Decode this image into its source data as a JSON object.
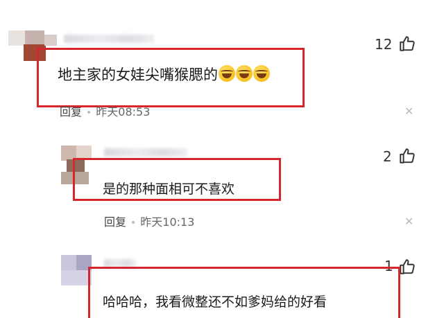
{
  "comments": [
    {
      "text": "地主家的女娃尖嘴猴腮的",
      "emojis": [
        "laughing-crying-emoji",
        "laughing-crying-emoji",
        "laughing-crying-emoji"
      ],
      "likes": "12",
      "reply_label": "回复",
      "time": "昨天08:53",
      "highlighted": true
    },
    {
      "text": "是的那种面相可不喜欢",
      "likes": "2",
      "reply_label": "回复",
      "time": "昨天10:13",
      "highlighted": true
    },
    {
      "text": "哈哈哈，我看微整还不如爹妈给的好看",
      "likes": "1",
      "highlighted": true
    }
  ],
  "icons": {
    "like": "thumbs-up-icon",
    "close": "close-icon"
  },
  "colors": {
    "highlight": "#d6262c",
    "text": "#1a1a1a",
    "meta": "#666666"
  }
}
